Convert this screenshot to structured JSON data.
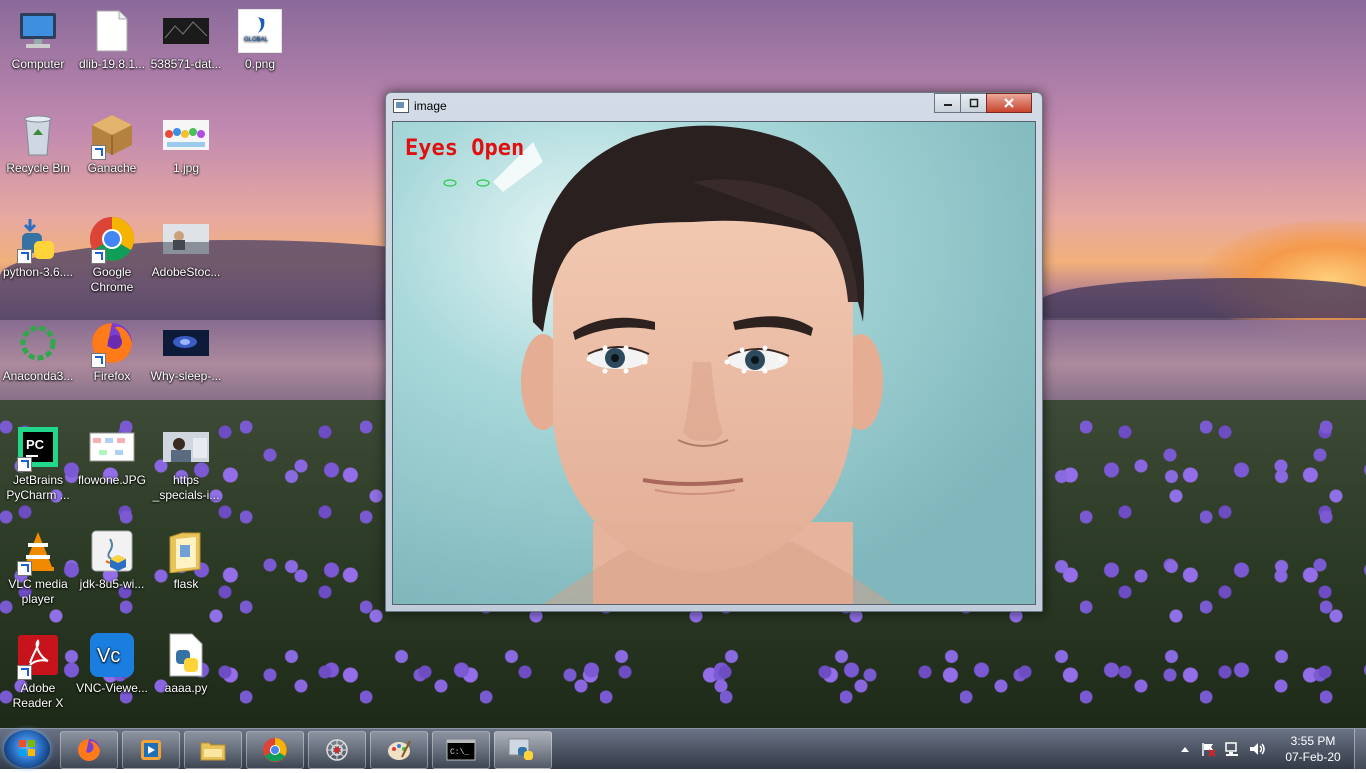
{
  "desktop": {
    "icons": [
      {
        "label": "Computer",
        "icon": "computer-icon"
      },
      {
        "label": "dlib-19.8.1...",
        "icon": "file-icon"
      },
      {
        "label": "538571-dat...",
        "icon": "image-thumbnail-icon"
      },
      {
        "label": "0.png",
        "icon": "image-thumbnail-icon"
      },
      {
        "label": "Recycle Bin",
        "icon": "recycle-bin-icon"
      },
      {
        "label": "Ganache",
        "icon": "ganache-icon"
      },
      {
        "label": "1.jpg",
        "icon": "image-thumbnail-icon"
      },
      {
        "label": "python-3.6....",
        "icon": "python-installer-icon"
      },
      {
        "label": "Google Chrome",
        "icon": "chrome-icon"
      },
      {
        "label": "AdobeStoc...",
        "icon": "image-thumbnail-icon"
      },
      {
        "label": "Anaconda3...",
        "icon": "anaconda-icon"
      },
      {
        "label": "Firefox",
        "icon": "firefox-icon"
      },
      {
        "label": "Why-sleep-...",
        "icon": "image-thumbnail-icon"
      },
      {
        "label": "JetBrains PyCharm ...",
        "icon": "pycharm-icon"
      },
      {
        "label": "flowone.JPG",
        "icon": "image-thumbnail-icon"
      },
      {
        "label": "https _specials-i...",
        "icon": "image-thumbnail-icon"
      },
      {
        "label": "VLC media player",
        "icon": "vlc-icon"
      },
      {
        "label": "jdk-8u5-wi...",
        "icon": "java-installer-icon"
      },
      {
        "label": "flask",
        "icon": "folder-icon"
      },
      {
        "label": "Adobe Reader X",
        "icon": "adobe-reader-icon"
      },
      {
        "label": "VNC-Viewe...",
        "icon": "vnc-icon"
      },
      {
        "label": "aaaa.py",
        "icon": "python-file-icon"
      }
    ]
  },
  "window": {
    "title": "image",
    "overlay_text": "Eyes Open",
    "overlay_color": "#e01010"
  },
  "taskbar": {
    "apps": [
      {
        "name": "firefox"
      },
      {
        "name": "media-player"
      },
      {
        "name": "file-explorer"
      },
      {
        "name": "chrome"
      },
      {
        "name": "tool"
      },
      {
        "name": "paint"
      },
      {
        "name": "command-prompt"
      },
      {
        "name": "python"
      }
    ],
    "clock": {
      "time": "3:55 PM",
      "date": "07-Feb-20"
    }
  },
  "colors": {
    "accent": "#2a6fc4",
    "overlay_text": "#e01010",
    "landmark_points": "#ffffff",
    "contour": "#22cc44"
  }
}
